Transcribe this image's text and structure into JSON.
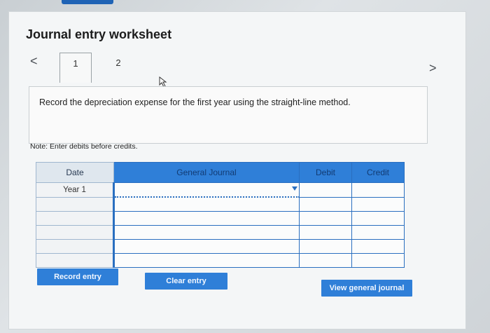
{
  "worksheet": {
    "title": "Journal entry worksheet",
    "nav": {
      "prev": "<",
      "next": ">"
    },
    "tabs": [
      "1",
      "2"
    ],
    "instruction": "Record the depreciation expense for the first year using the straight-line method.",
    "note": "Note: Enter debits before credits."
  },
  "table": {
    "headers": {
      "date": "Date",
      "account": "General Journal",
      "debit": "Debit",
      "credit": "Credit"
    },
    "rows": [
      {
        "date": "Year 1",
        "account": "",
        "debit": "",
        "credit": ""
      },
      {
        "date": "",
        "account": "",
        "debit": "",
        "credit": ""
      },
      {
        "date": "",
        "account": "",
        "debit": "",
        "credit": ""
      },
      {
        "date": "",
        "account": "",
        "debit": "",
        "credit": ""
      },
      {
        "date": "",
        "account": "",
        "debit": "",
        "credit": ""
      },
      {
        "date": "",
        "account": "",
        "debit": "",
        "credit": ""
      }
    ]
  },
  "buttons": {
    "record": "Record entry",
    "clear": "Clear entry",
    "view": "View general journal"
  },
  "colors": {
    "accent": "#2f7fd8",
    "accent_dark": "#2a6fc0",
    "panel": "#f4f6f7"
  }
}
